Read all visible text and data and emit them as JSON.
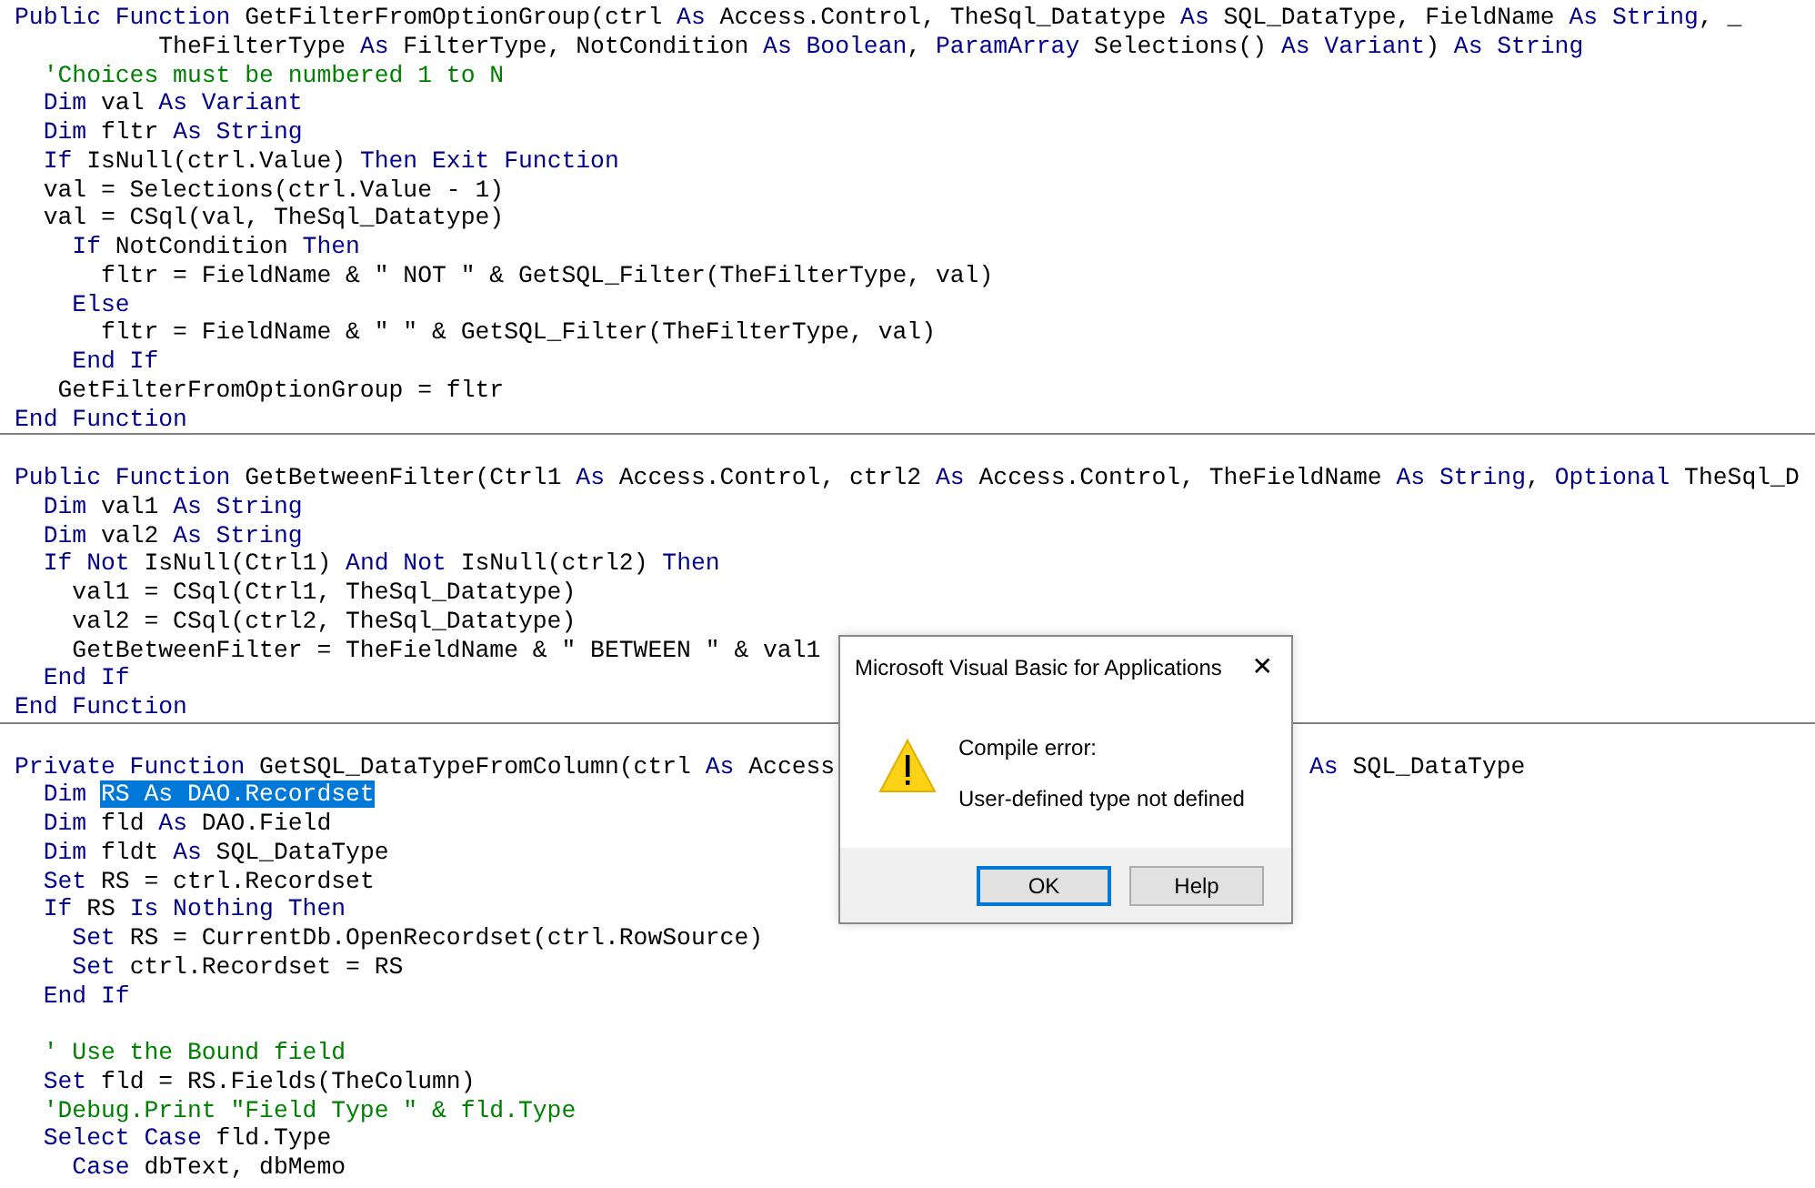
{
  "code_lines": [
    {
      "kind": "code",
      "segments": [
        {
          "kind": "keyword",
          "text": "Public Function"
        },
        {
          "kind": "plain",
          "text": " GetFilterFromOptionGroup(ctrl "
        },
        {
          "kind": "keyword",
          "text": "As"
        },
        {
          "kind": "plain",
          "text": " Access.Control, TheSql_Datatype "
        },
        {
          "kind": "keyword",
          "text": "As"
        },
        {
          "kind": "plain",
          "text": " SQL_DataType, FieldName "
        },
        {
          "kind": "keyword",
          "text": "As String"
        },
        {
          "kind": "plain",
          "text": ", _"
        }
      ]
    },
    {
      "kind": "code",
      "segments": [
        {
          "kind": "plain",
          "text": "          TheFilterType "
        },
        {
          "kind": "keyword",
          "text": "As"
        },
        {
          "kind": "plain",
          "text": " FilterType, NotCondition "
        },
        {
          "kind": "keyword",
          "text": "As Boolean"
        },
        {
          "kind": "plain",
          "text": ", "
        },
        {
          "kind": "keyword",
          "text": "ParamArray"
        },
        {
          "kind": "plain",
          "text": " Selections() "
        },
        {
          "kind": "keyword",
          "text": "As Variant"
        },
        {
          "kind": "plain",
          "text": ") "
        },
        {
          "kind": "keyword",
          "text": "As String"
        }
      ]
    },
    {
      "kind": "code",
      "segments": [
        {
          "kind": "comment",
          "text": "  'Choices must be numbered 1 to N"
        }
      ]
    },
    {
      "kind": "code",
      "segments": [
        {
          "kind": "keyword",
          "text": "  Dim"
        },
        {
          "kind": "plain",
          "text": " val "
        },
        {
          "kind": "keyword",
          "text": "As Variant"
        }
      ]
    },
    {
      "kind": "code",
      "segments": [
        {
          "kind": "keyword",
          "text": "  Dim"
        },
        {
          "kind": "plain",
          "text": " fltr "
        },
        {
          "kind": "keyword",
          "text": "As String"
        }
      ]
    },
    {
      "kind": "code",
      "segments": [
        {
          "kind": "keyword",
          "text": "  If"
        },
        {
          "kind": "plain",
          "text": " IsNull(ctrl.Value) "
        },
        {
          "kind": "keyword",
          "text": "Then Exit Function"
        }
      ]
    },
    {
      "kind": "code",
      "segments": [
        {
          "kind": "plain",
          "text": "  val = Selections(ctrl.Value - 1)"
        }
      ]
    },
    {
      "kind": "code",
      "segments": [
        {
          "kind": "plain",
          "text": "  val = CSql(val, TheSql_Datatype)"
        }
      ]
    },
    {
      "kind": "code",
      "segments": [
        {
          "kind": "keyword",
          "text": "    If"
        },
        {
          "kind": "plain",
          "text": " NotCondition "
        },
        {
          "kind": "keyword",
          "text": "Then"
        }
      ]
    },
    {
      "kind": "code",
      "segments": [
        {
          "kind": "plain",
          "text": "      fltr = FieldName & \" NOT \" & GetSQL_Filter(TheFilterType, val)"
        }
      ]
    },
    {
      "kind": "code",
      "segments": [
        {
          "kind": "keyword",
          "text": "    Else"
        }
      ]
    },
    {
      "kind": "code",
      "segments": [
        {
          "kind": "plain",
          "text": "      fltr = FieldName & \" \" & GetSQL_Filter(TheFilterType, val)"
        }
      ]
    },
    {
      "kind": "code",
      "segments": [
        {
          "kind": "keyword",
          "text": "    End If"
        }
      ]
    },
    {
      "kind": "code",
      "segments": [
        {
          "kind": "plain",
          "text": "   GetFilterFromOptionGroup = fltr"
        }
      ]
    },
    {
      "kind": "code",
      "segments": [
        {
          "kind": "keyword",
          "text": "End Function"
        }
      ]
    },
    {
      "kind": "divider"
    },
    {
      "kind": "blank"
    },
    {
      "kind": "code",
      "segments": [
        {
          "kind": "keyword",
          "text": "Public Function"
        },
        {
          "kind": "plain",
          "text": " GetBetweenFilter(Ctrl1 "
        },
        {
          "kind": "keyword",
          "text": "As"
        },
        {
          "kind": "plain",
          "text": " Access.Control, ctrl2 "
        },
        {
          "kind": "keyword",
          "text": "As"
        },
        {
          "kind": "plain",
          "text": " Access.Control, TheFieldName "
        },
        {
          "kind": "keyword",
          "text": "As String"
        },
        {
          "kind": "plain",
          "text": ", "
        },
        {
          "kind": "keyword",
          "text": "Optional"
        },
        {
          "kind": "plain",
          "text": " TheSql_D"
        }
      ]
    },
    {
      "kind": "code",
      "segments": [
        {
          "kind": "keyword",
          "text": "  Dim"
        },
        {
          "kind": "plain",
          "text": " val1 "
        },
        {
          "kind": "keyword",
          "text": "As String"
        }
      ]
    },
    {
      "kind": "code",
      "segments": [
        {
          "kind": "keyword",
          "text": "  Dim"
        },
        {
          "kind": "plain",
          "text": " val2 "
        },
        {
          "kind": "keyword",
          "text": "As String"
        }
      ]
    },
    {
      "kind": "code",
      "segments": [
        {
          "kind": "keyword",
          "text": "  If Not"
        },
        {
          "kind": "plain",
          "text": " IsNull(Ctrl1) "
        },
        {
          "kind": "keyword",
          "text": "And Not"
        },
        {
          "kind": "plain",
          "text": " IsNull(ctrl2) "
        },
        {
          "kind": "keyword",
          "text": "Then"
        }
      ]
    },
    {
      "kind": "code",
      "segments": [
        {
          "kind": "plain",
          "text": "    val1 = CSql(Ctrl1, TheSql_Datatype)"
        }
      ]
    },
    {
      "kind": "code",
      "segments": [
        {
          "kind": "plain",
          "text": "    val2 = CSql(ctrl2, TheSql_Datatype)"
        }
      ]
    },
    {
      "kind": "code",
      "segments": [
        {
          "kind": "plain",
          "text": "    GetBetweenFilter = TheFieldName & \" BETWEEN \" & val1"
        }
      ]
    },
    {
      "kind": "code",
      "segments": [
        {
          "kind": "keyword",
          "text": "  End If"
        }
      ]
    },
    {
      "kind": "code",
      "segments": [
        {
          "kind": "keyword",
          "text": "End Function"
        }
      ]
    },
    {
      "kind": "divider"
    },
    {
      "kind": "blank"
    },
    {
      "kind": "code",
      "segments": [
        {
          "kind": "keyword",
          "text": "Private Function"
        },
        {
          "kind": "plain",
          "text": " GetSQL_DataTypeFromColumn(ctrl "
        },
        {
          "kind": "keyword",
          "text": "As"
        },
        {
          "kind": "plain",
          "text": " Access"
        }
      ],
      "tail_segments": [
        {
          "kind": "keyword",
          "text": "As"
        },
        {
          "kind": "plain",
          "text": " SQL_DataType"
        }
      ]
    },
    {
      "kind": "code",
      "segments": [
        {
          "kind": "keyword",
          "text": "  Dim "
        },
        {
          "kind": "selected",
          "text": "RS As DAO.Recordset"
        }
      ]
    },
    {
      "kind": "code",
      "segments": [
        {
          "kind": "keyword",
          "text": "  Dim"
        },
        {
          "kind": "plain",
          "text": " fld "
        },
        {
          "kind": "keyword",
          "text": "As"
        },
        {
          "kind": "plain",
          "text": " DAO.Field"
        }
      ]
    },
    {
      "kind": "code",
      "segments": [
        {
          "kind": "keyword",
          "text": "  Dim"
        },
        {
          "kind": "plain",
          "text": " fldt "
        },
        {
          "kind": "keyword",
          "text": "As"
        },
        {
          "kind": "plain",
          "text": " SQL_DataType"
        }
      ]
    },
    {
      "kind": "code",
      "segments": [
        {
          "kind": "keyword",
          "text": "  Set"
        },
        {
          "kind": "plain",
          "text": " RS = ctrl.Recordset"
        }
      ]
    },
    {
      "kind": "code",
      "segments": [
        {
          "kind": "keyword",
          "text": "  If"
        },
        {
          "kind": "plain",
          "text": " RS "
        },
        {
          "kind": "keyword",
          "text": "Is Nothing Then"
        }
      ]
    },
    {
      "kind": "code",
      "segments": [
        {
          "kind": "keyword",
          "text": "    Set"
        },
        {
          "kind": "plain",
          "text": " RS = CurrentDb.OpenRecordset(ctrl.RowSource)"
        }
      ]
    },
    {
      "kind": "code",
      "segments": [
        {
          "kind": "keyword",
          "text": "    Set"
        },
        {
          "kind": "plain",
          "text": " ctrl.Recordset = RS"
        }
      ]
    },
    {
      "kind": "code",
      "segments": [
        {
          "kind": "keyword",
          "text": "  End If"
        }
      ]
    },
    {
      "kind": "blank"
    },
    {
      "kind": "code",
      "segments": [
        {
          "kind": "comment",
          "text": "  ' Use the Bound field"
        }
      ]
    },
    {
      "kind": "code",
      "segments": [
        {
          "kind": "keyword",
          "text": "  Set"
        },
        {
          "kind": "plain",
          "text": " fld = RS.Fields(TheColumn)"
        }
      ]
    },
    {
      "kind": "code",
      "segments": [
        {
          "kind": "comment",
          "text": "  'Debug.Print \"Field Type \" & fld.Type"
        }
      ]
    },
    {
      "kind": "code",
      "segments": [
        {
          "kind": "keyword",
          "text": "  Select Case"
        },
        {
          "kind": "plain",
          "text": " fld.Type"
        }
      ]
    },
    {
      "kind": "code",
      "segments": [
        {
          "kind": "keyword",
          "text": "    Case"
        },
        {
          "kind": "plain",
          "text": " dbText, dbMemo"
        }
      ]
    }
  ],
  "dialog": {
    "title": "Microsoft Visual Basic for Applications",
    "close": "✕",
    "heading": "Compile error:",
    "message": "User-defined type not defined",
    "buttons": [
      {
        "label": "OK",
        "selected": true
      },
      {
        "label": "Help",
        "selected": false
      }
    ]
  }
}
